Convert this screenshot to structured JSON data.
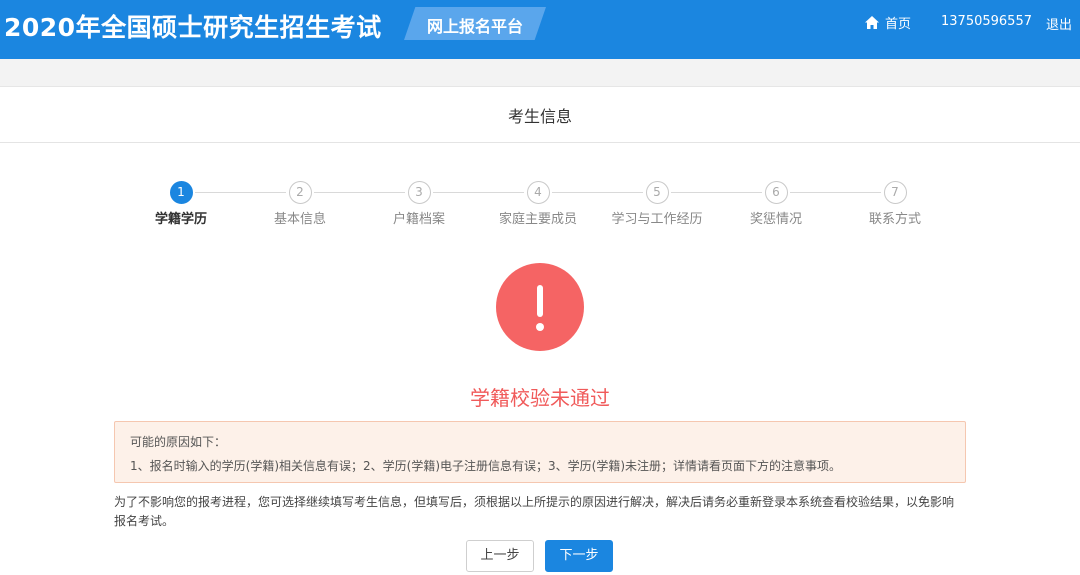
{
  "header": {
    "title": "2020年全国硕士研究生招生考试",
    "platform": "网上报名平台",
    "home_label": "首页",
    "phone": "13750596557",
    "logout_label": "退出"
  },
  "section_title": "考生信息",
  "steps": [
    {
      "num": "1",
      "label": "学籍学历"
    },
    {
      "num": "2",
      "label": "基本信息"
    },
    {
      "num": "3",
      "label": "户籍档案"
    },
    {
      "num": "4",
      "label": "家庭主要成员"
    },
    {
      "num": "5",
      "label": "学习与工作经历"
    },
    {
      "num": "6",
      "label": "奖惩情况"
    },
    {
      "num": "7",
      "label": "联系方式"
    }
  ],
  "active_step": 1,
  "result": {
    "title": "学籍校验未通过"
  },
  "reason": {
    "title": "可能的原因如下：",
    "text": "1、报名时输入的学历(学籍)相关信息有误；2、学历(学籍)电子注册信息有误；3、学历(学籍)未注册；详情请看页面下方的注意事项。"
  },
  "notice": "为了不影响您的报考进程，您可选择继续填写考生信息，但填写后，须根据以上所提示的原因进行解决，解决后请务必重新登录本系统查看校验结果，以免影响报名考试。",
  "buttons": {
    "prev": "上一步",
    "next": "下一步"
  },
  "colors": {
    "primary": "#1b86e0",
    "error": "#f56464",
    "reason_bg": "#fdf1e9"
  }
}
